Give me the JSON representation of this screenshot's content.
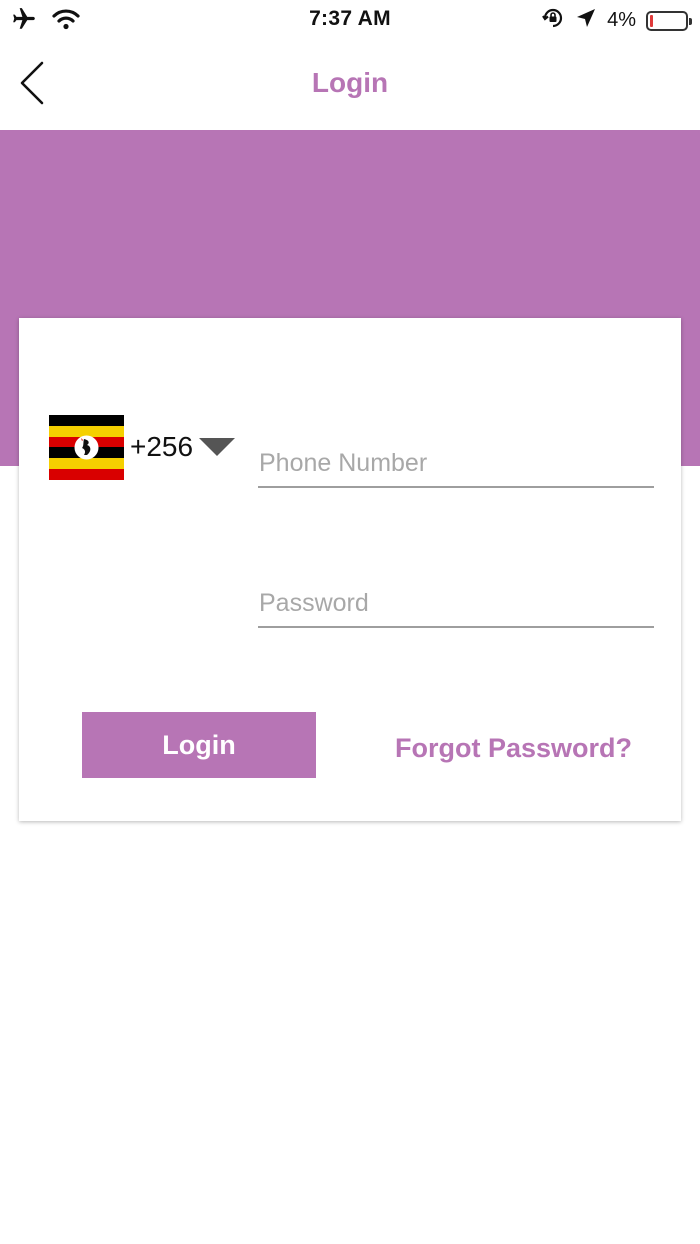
{
  "status_bar": {
    "time": "7:37 AM",
    "battery_percent": "4%",
    "battery_level": 0.04,
    "icons": [
      "airplane-icon",
      "wifi-icon",
      "rotation-lock-icon",
      "location-arrow-icon",
      "battery-icon"
    ]
  },
  "nav": {
    "title": "Login",
    "back_icon": "chevron-left-icon"
  },
  "login_form": {
    "country": {
      "flag": "uganda-flag-icon",
      "dial_code": "+256",
      "dropdown_icon": "caret-down-icon"
    },
    "phone": {
      "placeholder": "Phone Number",
      "value": ""
    },
    "password": {
      "placeholder": "Password",
      "value": ""
    },
    "login_label": "Login",
    "forgot_label": "Forgot Password?"
  },
  "colors": {
    "accent": "#b775b5",
    "white": "#ffffff",
    "field_underline": "#9e9e9e",
    "placeholder": "#a8a8a8"
  }
}
